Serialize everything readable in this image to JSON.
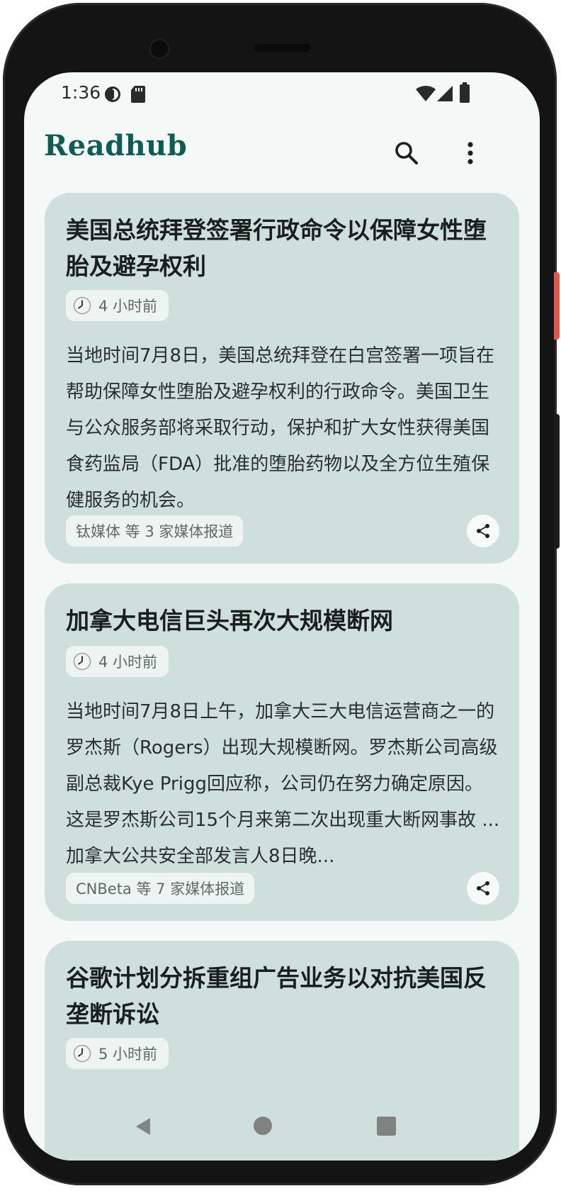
{
  "status_bar": {
    "time": "1:36",
    "icons": [
      "data-saver-icon",
      "sd-card-icon",
      "wifi-icon",
      "signal-icon",
      "battery-icon"
    ]
  },
  "app_bar": {
    "title": "Readhub",
    "actions": [
      "search-icon",
      "more-vert-icon"
    ]
  },
  "theme": {
    "accent": "#0f5d52",
    "card_bg": "#cfe0dc",
    "screen_bg": "#f4f9f7"
  },
  "cards": [
    {
      "title": "美国总统拜登签署行政命令以保障女性堕胎及避孕权利",
      "time": "4 小时前",
      "body": "当地时间7月8日，美国总统拜登在白宫签署一项旨在帮助保障女性堕胎及避孕权利的行政命令。美国卫生与公众服务部将采取行动，保护和扩大女性获得美国食药监局（FDA）批准的堕胎药物以及全方位生殖保健服务的机会。",
      "source": "钛媒体 等 3 家媒体报道"
    },
    {
      "title": "加拿大电信巨头再次大规模断网",
      "time": "4 小时前",
      "body": "当地时间7月8日上午，加拿大三大电信运营商之一的罗杰斯（Rogers）出现大规模断网。罗杰斯公司高级副总裁Kye Prigg回应称，公司仍在努力确定原因。这是罗杰斯公司15个月来第二次出现重大断网事故 ... 加拿大公共安全部发言人8日晚...",
      "source": "CNBeta 等 7 家媒体报道"
    },
    {
      "title": "谷歌计划分拆重组广告业务以对抗美国反垄断诉讼",
      "time": "5 小时前"
    }
  ],
  "nav_bar": [
    "back-icon",
    "home-icon",
    "recents-icon"
  ]
}
